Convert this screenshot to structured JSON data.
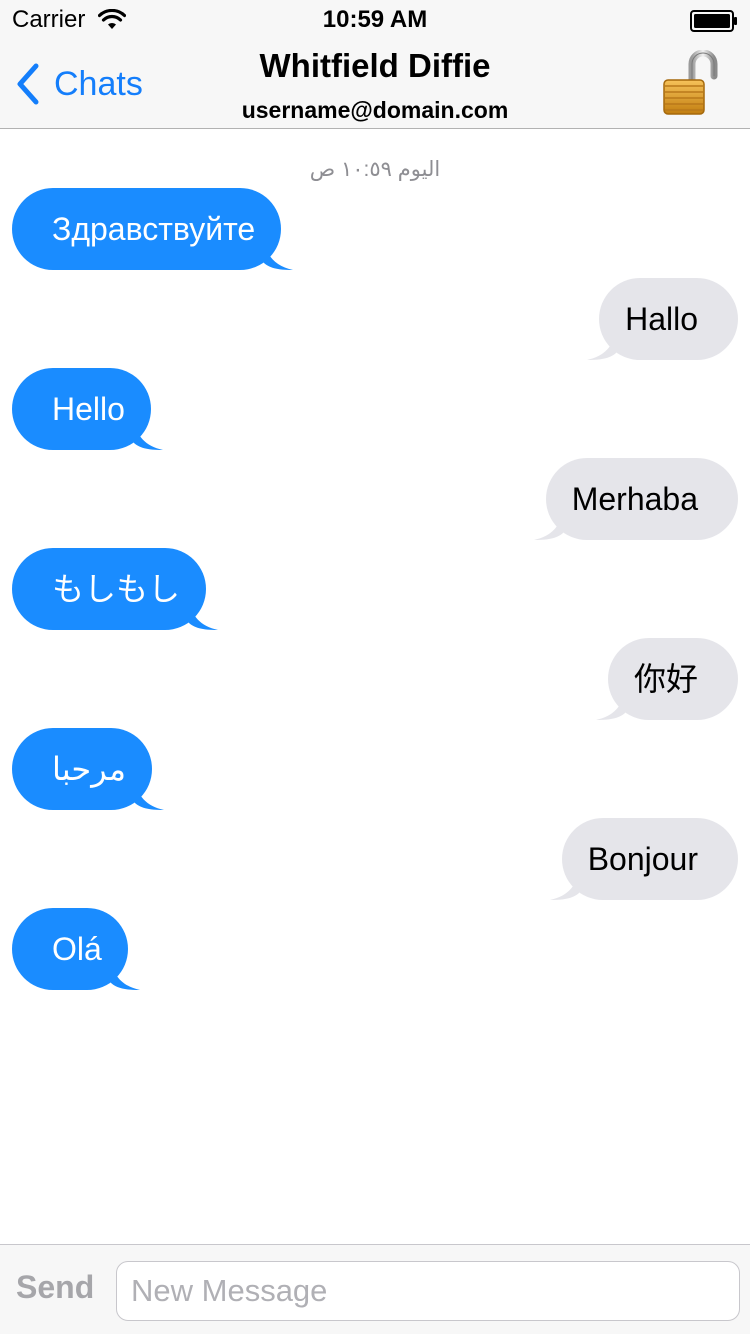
{
  "status_bar": {
    "carrier": "Carrier",
    "time": "10:59 AM",
    "icons": [
      "wifi-icon",
      "battery-icon"
    ]
  },
  "nav": {
    "back_label": "Chats",
    "title": "Whitfield Diffie",
    "subtitle": "username@domain.com",
    "lock_icon": "unlocked-padlock-icon"
  },
  "chat": {
    "timestamp": "اليوم ١٠:٥٩ ص",
    "messages": [
      {
        "direction": "in",
        "text": "Здравствуйте"
      },
      {
        "direction": "out",
        "text": "Hallo"
      },
      {
        "direction": "in",
        "text": "Hello"
      },
      {
        "direction": "out",
        "text": "Merhaba"
      },
      {
        "direction": "in",
        "text": "もしもし"
      },
      {
        "direction": "out",
        "text": "你好"
      },
      {
        "direction": "in",
        "text": "مرحبا"
      },
      {
        "direction": "out",
        "text": "Bonjour"
      },
      {
        "direction": "in",
        "text": "Olá"
      }
    ]
  },
  "input_bar": {
    "send_label": "Send",
    "placeholder": "New Message",
    "value": ""
  },
  "colors": {
    "accent": "#147efb",
    "incoming_bubble": "#1a8cff",
    "outgoing_bubble": "#e5e5ea",
    "bar_background": "#f7f7f7"
  }
}
